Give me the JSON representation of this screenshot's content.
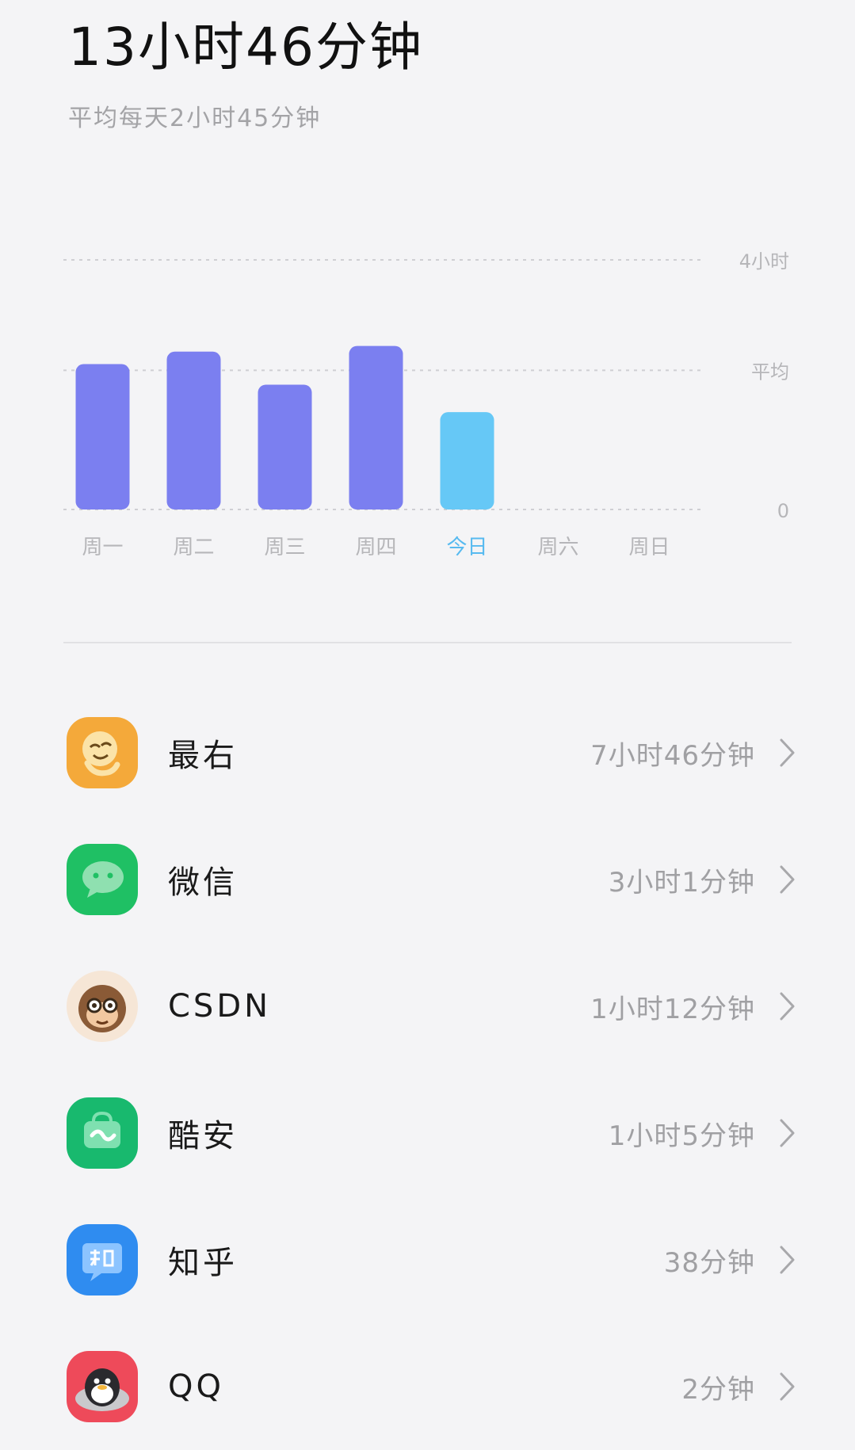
{
  "header": {
    "total_time": "13小时46分钟",
    "daily_average": "平均每天2小时45分钟"
  },
  "chart_data": {
    "type": "bar",
    "categories": [
      "周一",
      "周二",
      "周三",
      "周四",
      "今日",
      "周六",
      "周日"
    ],
    "values": [
      2.33,
      2.53,
      2.0,
      2.62,
      1.56,
      0,
      0
    ],
    "highlight_category": "今日",
    "ylim": [
      0,
      4
    ],
    "reference_lines": [
      {
        "label": "4小时",
        "value": 4
      },
      {
        "label": "平均",
        "value": 2.23
      },
      {
        "label": "0",
        "value": 0
      }
    ],
    "colors": {
      "bar": "#7b7ff0",
      "today": "#66c8f6",
      "label": "#b6b6b9",
      "today_label": "#57baf0",
      "gridline": "#cfcfd3"
    },
    "title": "",
    "xlabel": "",
    "ylabel": ""
  },
  "apps": [
    {
      "name": "最右",
      "time": "7小时46分钟",
      "icon": "zuiyou-app-icon",
      "color": "#f4a93a"
    },
    {
      "name": "微信",
      "time": "3小时1分钟",
      "icon": "wechat-app-icon",
      "color": "#1fc064"
    },
    {
      "name": "CSDN",
      "time": "1小时12分钟",
      "icon": "csdn-app-icon",
      "color": "#f6e6d6"
    },
    {
      "name": "酷安",
      "time": "1小时5分钟",
      "icon": "coolapk-app-icon",
      "color": "#18b96e"
    },
    {
      "name": "知乎",
      "time": "38分钟",
      "icon": "zhihu-app-icon",
      "color": "#2f8cf0"
    },
    {
      "name": "QQ",
      "time": "2分钟",
      "icon": "qq-app-icon",
      "color": "#ee4a5a"
    }
  ],
  "icons": {
    "chevron": "chevron-right-icon"
  }
}
